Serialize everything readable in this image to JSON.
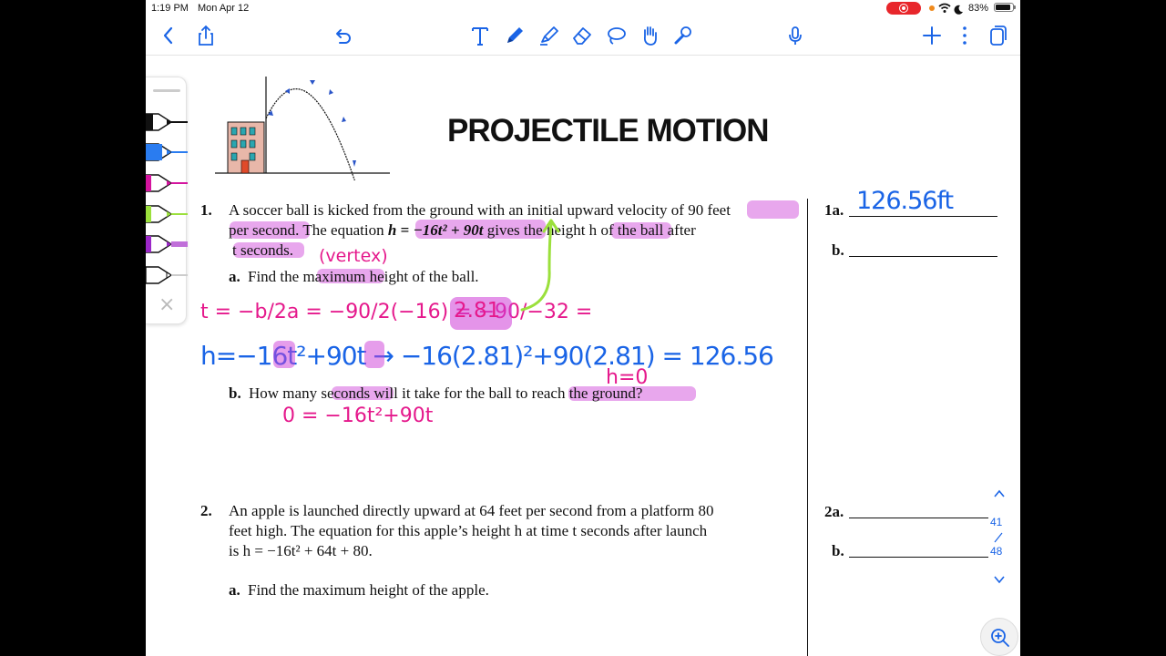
{
  "status_bar": {
    "time": "1:19 PM",
    "date": "Mon Apr 12",
    "battery": "83%",
    "icons": [
      "screen-recording-icon",
      "wifi-icon",
      "moon-icon",
      "battery-icon"
    ]
  },
  "toolbar": {
    "left_icons": [
      "back-chevron-icon",
      "share-icon",
      "undo-icon"
    ],
    "tool_icons": [
      "text-tool-icon",
      "pen-tool-icon",
      "highlighter-tool-icon",
      "eraser-tool-icon",
      "lasso-tool-icon",
      "hand-tool-icon",
      "laser-pointer-icon"
    ],
    "right_icons": [
      "microphone-icon",
      "add-icon",
      "more-icon",
      "pages-icon"
    ]
  },
  "pen_tray": {
    "colors": [
      "#111111",
      "#2a7cf0",
      "#d4149e",
      "#9be03c",
      "#9b27c8",
      "#ffffff"
    ],
    "close_label": "×"
  },
  "worksheet": {
    "title": "PROJECTILE MOTION",
    "q1": {
      "number": "1.",
      "line1_a": "A soccer ball is kicked from the ground with an initial upward velocity of ",
      "line1_b": "90 feet",
      "line2_a": "per second",
      "line2_b": ".  The equation ",
      "equation": "h = −16t² + 90t",
      "line2_c": " gives the ",
      "line2_d": "height h",
      "line2_e": " of the ball after",
      "line3": "t seconds.",
      "part_a_label": "a.",
      "part_a_text": "Find the maximum height of the ball.",
      "part_b_label": "b.",
      "part_b_text": "How many seconds will it take for the ball to reach the ground?"
    },
    "q2": {
      "number": "2.",
      "line1": "An apple is launched directly upward at 64 feet per second from a platform 80",
      "line2": "feet high.  The equation for this apple’s height h at time t seconds after launch",
      "line3": "is h = −16t² + 64t + 80.",
      "part_a_label": "a.",
      "part_a_text": "Find the maximum height of the apple."
    },
    "answers": {
      "a1_label": "1a.",
      "a1_value": "126.56ft",
      "b1_label": "b.",
      "a2_label": "2a.",
      "b2_label": "b."
    }
  },
  "handwriting": {
    "vertex_note": "(vertex)",
    "vertex_formula": "t = −b/2a = −90/2(−16) = −90/−32 =",
    "vertex_result": "2.81",
    "height_calc": "h=−16t²+90t → −16(2.81)²+90(2.81) = 126.56",
    "ground_note": "h=0",
    "ground_eq": "0 = −16t²+90t"
  },
  "page_nav": {
    "current": "41",
    "total": "48"
  },
  "colors": {
    "accent_blue": "#1a64e6",
    "ink_pink": "#e5198c",
    "highlight": "#cd3cd7",
    "ink_green": "#9be03c",
    "record_red": "#e8262b"
  }
}
